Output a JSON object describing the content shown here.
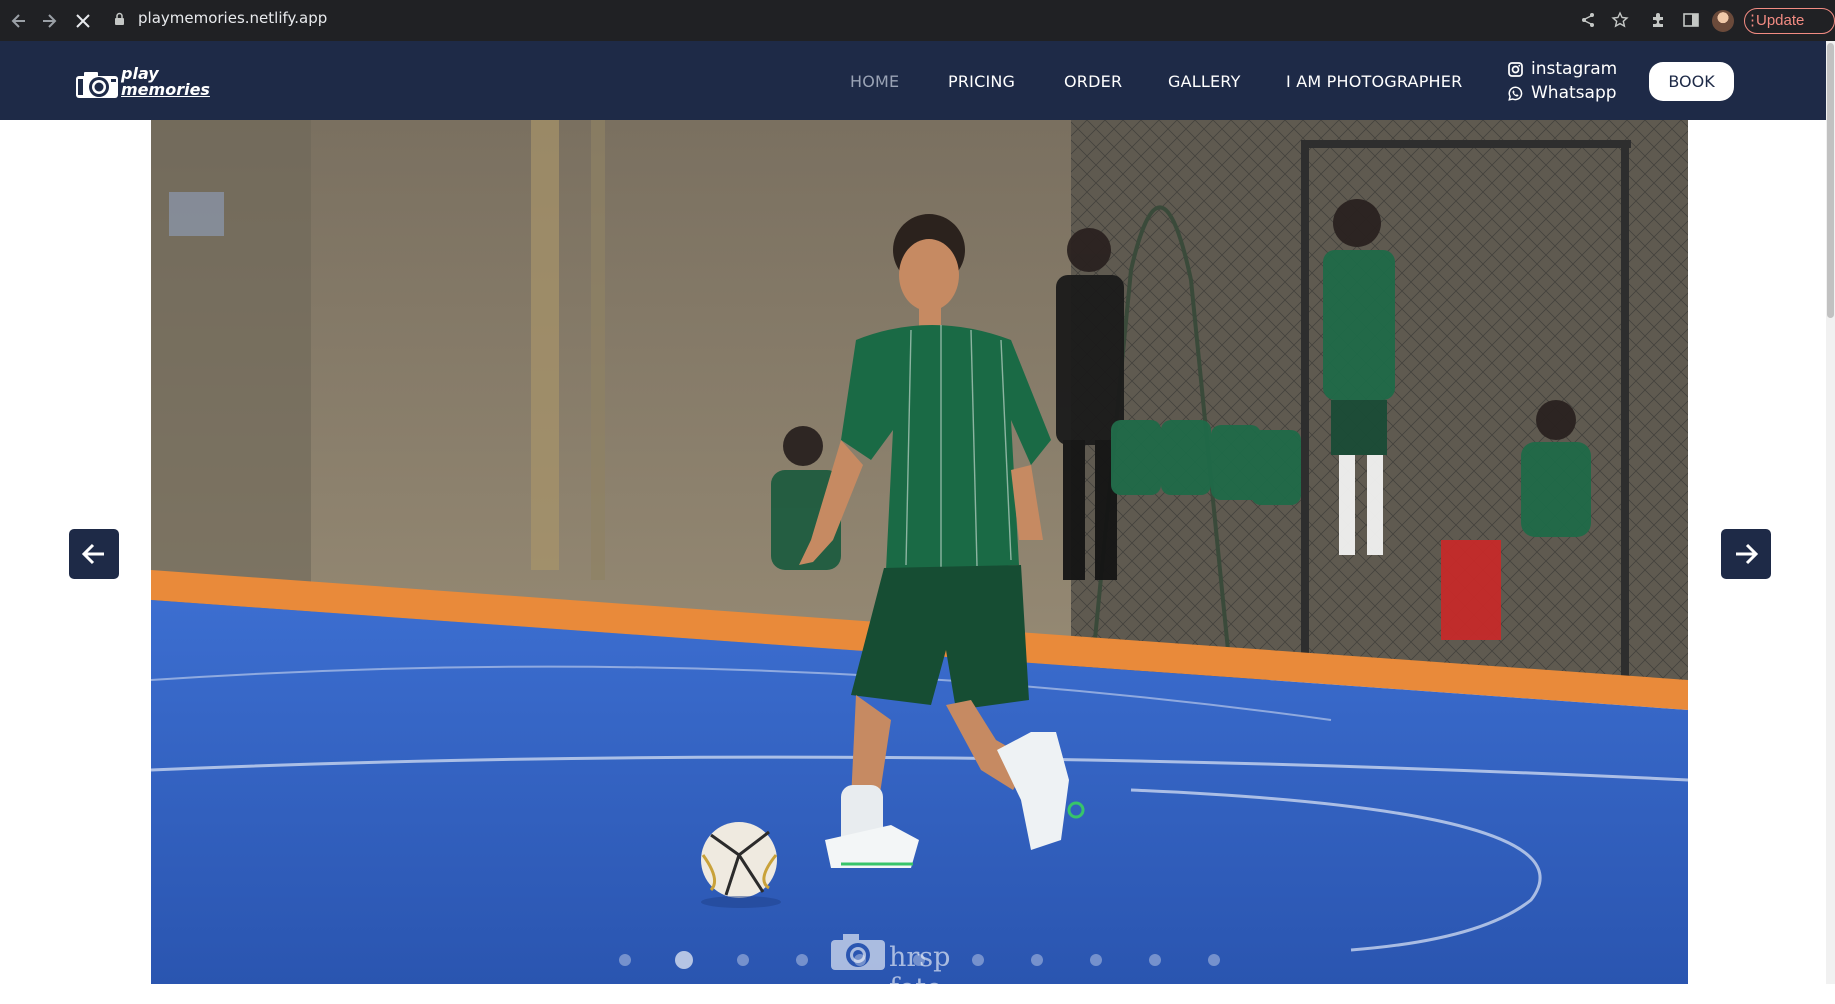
{
  "browser": {
    "url": "playmemories.netlify.app",
    "update_label": "Update",
    "icons": [
      "back-icon",
      "forward-icon",
      "stop-icon",
      "lock-icon",
      "share-icon",
      "star-icon",
      "extensions-icon",
      "sidepanel-icon",
      "profile-avatar",
      "menu-icon"
    ]
  },
  "header": {
    "logo": {
      "line1": "play",
      "line2": "memories"
    },
    "nav": [
      {
        "label": "HOME",
        "active": true
      },
      {
        "label": "PRICING",
        "active": false
      },
      {
        "label": "ORDER",
        "active": false
      },
      {
        "label": "GALLERY",
        "active": false
      },
      {
        "label": "I AM PHOTOGRAPHER",
        "active": false
      }
    ],
    "social": [
      {
        "label": "instagram",
        "icon": "instagram-icon"
      },
      {
        "label": "Whatsapp",
        "icon": "whatsapp-icon"
      }
    ],
    "book_label": "BOOK"
  },
  "carousel": {
    "slide_count": 11,
    "active_slide": 2,
    "watermark": "hrsp foto"
  },
  "colors": {
    "header_bg": "#1e2a47",
    "active_nav": "#9aa3b5",
    "court_blue": "#2f63c9",
    "wall": "#8a7f6f"
  }
}
